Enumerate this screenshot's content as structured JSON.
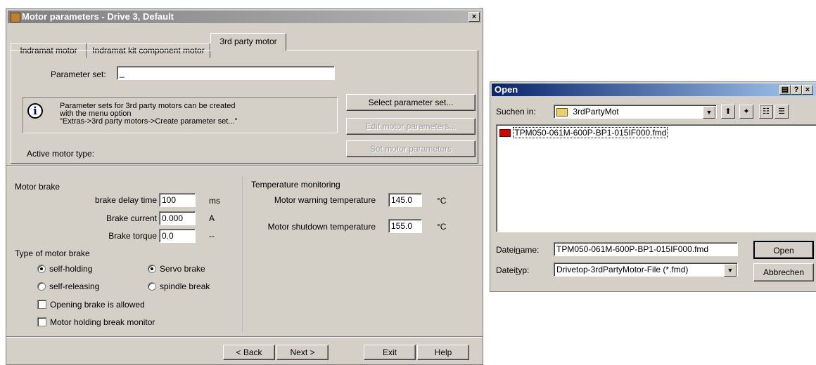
{
  "motor_dialog": {
    "title": "Motor parameters - Drive 3,  Default",
    "close_label": "×",
    "tabs": [
      {
        "label": "Indramat motor"
      },
      {
        "label": "Indramat kit component motor"
      },
      {
        "label": "3rd party motor"
      }
    ],
    "parameter_set_label": "Parameter set:",
    "parameter_set_value": "_",
    "info_text": "Parameter sets for 3rd party motors can be created\nwith the menu option\n\"Extras->3rd party motors->Create parameter set...\"",
    "active_motor_type_label": "Active motor type:",
    "buttons": {
      "select_parameter_set": "Select parameter set...",
      "edit_motor_parameters": "Edit motor parameters...",
      "set_motor_parameters": "Set motor parameters"
    },
    "motor_brake": {
      "heading": "Motor brake",
      "brake_delay_label": "brake delay time",
      "brake_delay_value": "100",
      "brake_delay_unit": "ms",
      "brake_current_label": "Brake current",
      "brake_current_value": "0.000",
      "brake_current_unit": "A",
      "brake_torque_label": "Brake torque",
      "brake_torque_value": "0.0",
      "brake_torque_unit": "--"
    },
    "brake_type": {
      "heading": "Type of motor brake",
      "self_holding": "self-holding",
      "servo_brake": "Servo brake",
      "self_releasing": "self-releasing",
      "spindle_break": "spindle break",
      "opening_allowed": "Opening brake is allowed",
      "holding_monitor": "Motor holding break monitor"
    },
    "temperature": {
      "heading": "Temperature monitoring",
      "warning_label": "Motor warning temperature",
      "warning_value": "145.0",
      "warning_unit": "°C",
      "shutdown_label": "Motor shutdown temperature",
      "shutdown_value": "155.0",
      "shutdown_unit": "°C"
    },
    "nav": {
      "back": "< Back",
      "next": "Next >",
      "exit": "Exit",
      "help": "Help"
    }
  },
  "open_dialog": {
    "title": "Open",
    "title_buttons": [
      "?",
      "×"
    ],
    "look_in_label": "Suchen in:",
    "look_in_value": "3rdPartyMot",
    "files": [
      "TPM050-061M-600P-BP1-015IF000.fmd"
    ],
    "filename_label": "Dateiname:",
    "filename_value": "TPM050-061M-600P-BP1-015IF000.fmd",
    "filetype_label": "Dateityp:",
    "filetype_value": "Drivetop-3rdPartyMotor-File (*.fmd)",
    "open_button": "Open",
    "cancel_button": "Abbrechen"
  }
}
